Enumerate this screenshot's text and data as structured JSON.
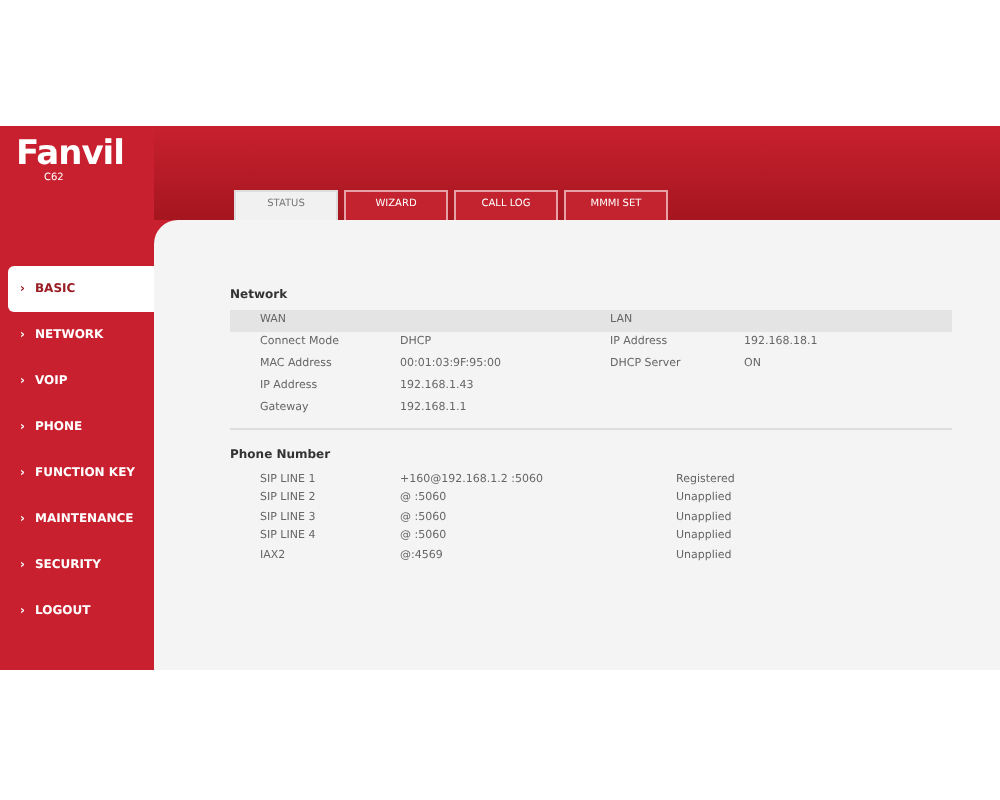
{
  "logo": {
    "brand": "Fanvil",
    "model": "C62"
  },
  "tabs": [
    {
      "label": "STATUS",
      "selected": true
    },
    {
      "label": "WIZARD",
      "selected": false
    },
    {
      "label": "CALL LOG",
      "selected": false
    },
    {
      "label": "MMMI SET",
      "selected": false
    }
  ],
  "sidebar": {
    "items": [
      {
        "marker": "›",
        "label": "BASIC",
        "selected": true
      },
      {
        "marker": "›",
        "label": "NETWORK",
        "selected": false
      },
      {
        "marker": "›",
        "label": "VOIP",
        "selected": false
      },
      {
        "marker": "›",
        "label": "PHONE",
        "selected": false
      },
      {
        "marker": "›",
        "label": "FUNCTION KEY",
        "selected": false
      },
      {
        "marker": "›",
        "label": "MAINTENANCE",
        "selected": false
      },
      {
        "marker": "›",
        "label": "SECURITY",
        "selected": false
      },
      {
        "marker": "›",
        "label": "LOGOUT",
        "selected": false
      }
    ]
  },
  "network": {
    "title": "Network",
    "wan_heading": "WAN",
    "lan_heading": "LAN",
    "rows": [
      {
        "label": "Connect Mode",
        "value": "DHCP",
        "lan_label": "IP Address",
        "lan_value": "192.168.18.1"
      },
      {
        "label": "MAC Address",
        "value": "00:01:03:9F:95:00",
        "lan_label": "DHCP Server",
        "lan_value": "ON"
      },
      {
        "label": "IP Address",
        "value": "192.168.1.43"
      },
      {
        "label": "Gateway",
        "value": "192.168.1.1"
      }
    ]
  },
  "phone": {
    "title": "Phone Number",
    "rows": [
      {
        "line": "SIP LINE 1",
        "account": "+160@192.168.1.2 :5060",
        "status": "Registered"
      },
      {
        "line": "SIP LINE 2",
        "account": "@ :5060",
        "status": "Unapplied"
      },
      {
        "line": "SIP LINE 3",
        "account": "@ :5060",
        "status": "Unapplied"
      },
      {
        "line": "SIP LINE 4",
        "account": "@ :5060",
        "status": "Unapplied"
      },
      {
        "line": "IAX2",
        "account": "@:4569",
        "status": "Unapplied"
      }
    ]
  }
}
